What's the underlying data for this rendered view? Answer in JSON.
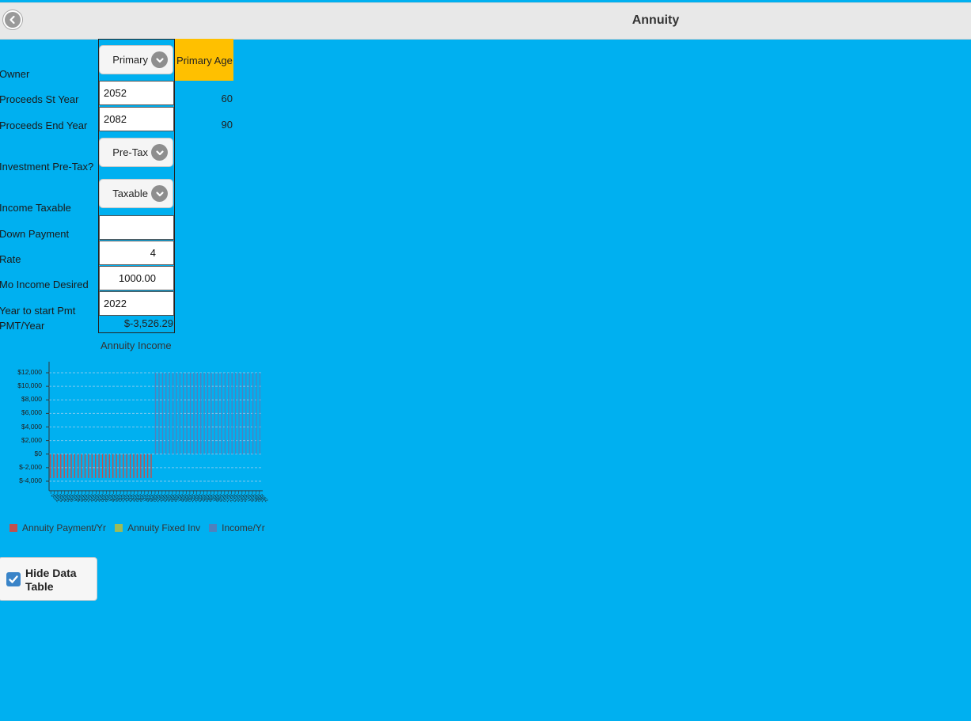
{
  "header": {
    "title": "Annuity",
    "back_icon": "chevron-left-icon"
  },
  "form": {
    "labels": {
      "owner": "Owner",
      "proceeds_start": "Proceeds St Year",
      "proceeds_end": "Proceeds End Year",
      "investment_pretax": "Investment Pre-Tax?",
      "income_taxable": "Income Taxable",
      "down_payment": "Down Payment",
      "rate": "Rate",
      "mo_income": "Mo Income Desired",
      "year_start_pmt": "Year to start Pmt",
      "pmt_year": "PMT/Year"
    },
    "owner_select": "Primary",
    "proceeds_start_value": "2052",
    "proceeds_end_value": "2082",
    "investment_pretax_select": "Pre-Tax",
    "income_taxable_select": "Taxable",
    "down_payment_value": "",
    "rate_value": "4",
    "mo_income_value": "1000.00",
    "year_start_pmt_value": "2022",
    "pmt_year_value": "$-3,526.29",
    "age_header": "Primary Age",
    "age_start": "60",
    "age_end": "90"
  },
  "chart_data": {
    "type": "bar",
    "title": "Annuity Income",
    "ylim": [
      -4000,
      12000
    ],
    "yticks": [
      "$12,000",
      "$10,000",
      "$8,000",
      "$6,000",
      "$4,000",
      "$2,000",
      "$0",
      "$-2,000",
      "$-4,000"
    ],
    "ytick_values": [
      12000,
      10000,
      8000,
      6000,
      4000,
      2000,
      0,
      -2000,
      -4000
    ],
    "grid": true,
    "legend_placement": "bottom",
    "colors": {
      "payment": "#c0504d",
      "fixed_inv": "#9bbb59",
      "income": "#4f81bd"
    },
    "series": [
      {
        "name": "Annuity Payment/Yr",
        "range": [
          2022,
          2051
        ],
        "value": -3526.29
      },
      {
        "name": "Annuity Fixed Inv",
        "range": [
          2022,
          2082
        ],
        "value": 0
      },
      {
        "name": "Income/Yr",
        "range": [
          2052,
          2082
        ],
        "value": 12000
      }
    ],
    "x_start": 2022,
    "x_end": 2082
  },
  "hide_table": {
    "label": "Hide Data Table",
    "checked": true
  }
}
